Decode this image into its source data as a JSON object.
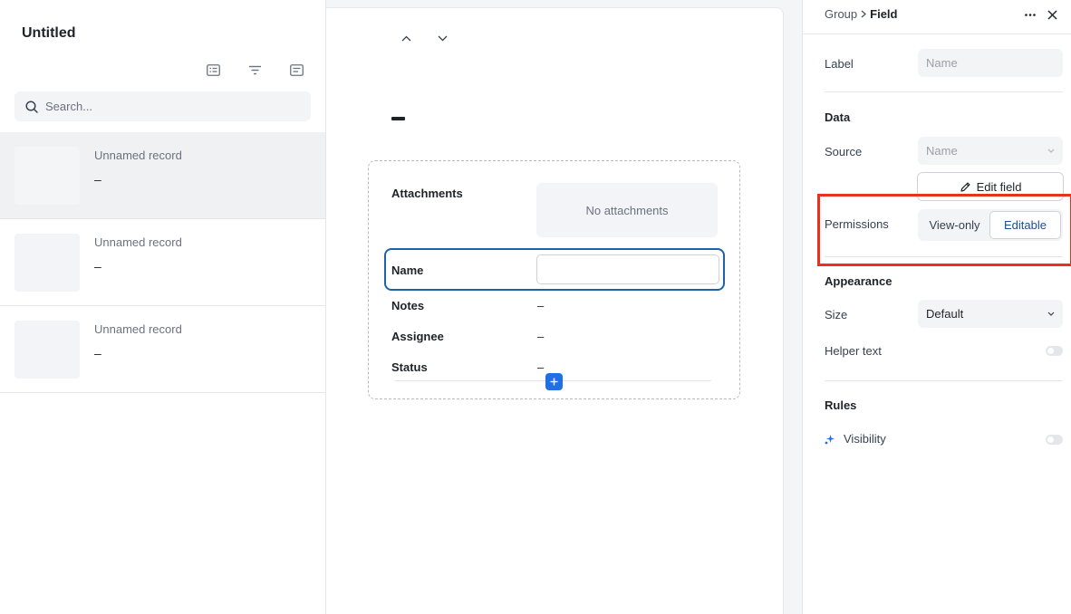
{
  "left": {
    "title": "Untitled",
    "search_placeholder": "Search...",
    "records": [
      {
        "name": "Unnamed record",
        "value": "–"
      },
      {
        "name": "Unnamed record",
        "value": "–"
      },
      {
        "name": "Unnamed record",
        "value": "–"
      }
    ]
  },
  "center": {
    "fields": {
      "attachments_label": "Attachments",
      "attachments_empty": "No attachments",
      "name_label": "Name",
      "notes_label": "Notes",
      "notes_value": "–",
      "assignee_label": "Assignee",
      "assignee_value": "–",
      "status_label": "Status",
      "status_value": "–"
    }
  },
  "right": {
    "breadcrumb_parent": "Group",
    "breadcrumb_current": "Field",
    "label_label": "Label",
    "label_placeholder": "Name",
    "data_section": "Data",
    "source_label": "Source",
    "source_value": "Name",
    "edit_field_label": "Edit field",
    "permissions_label": "Permissions",
    "perm_view_only": "View-only",
    "perm_editable": "Editable",
    "appearance_section": "Appearance",
    "size_label": "Size",
    "size_value": "Default",
    "helper_text_label": "Helper text",
    "rules_section": "Rules",
    "visibility_label": "Visibility",
    "highlight_color": "#e8321e",
    "accent_color": "#1f6fe5"
  }
}
